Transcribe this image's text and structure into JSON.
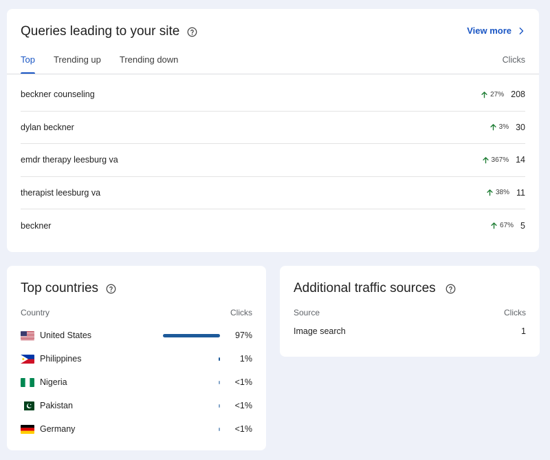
{
  "queries": {
    "title": "Queries leading to your site",
    "view_more": "View more",
    "tabs": [
      {
        "label": "Top",
        "active": true
      },
      {
        "label": "Trending up",
        "active": false
      },
      {
        "label": "Trending down",
        "active": false
      }
    ],
    "clicks_header": "Clicks",
    "rows": [
      {
        "query": "beckner counseling",
        "change": "27%",
        "clicks": "208"
      },
      {
        "query": "dylan beckner",
        "change": "3%",
        "clicks": "30"
      },
      {
        "query": "emdr therapy leesburg va",
        "change": "367%",
        "clicks": "14"
      },
      {
        "query": "therapist leesburg va",
        "change": "38%",
        "clicks": "11"
      },
      {
        "query": "beckner",
        "change": "67%",
        "clicks": "5"
      }
    ],
    "trend_icon": "arrow-up-icon",
    "trend_color": "#1e7d34"
  },
  "countries": {
    "title": "Top countries",
    "col_country": "Country",
    "col_clicks": "Clicks",
    "rows": [
      {
        "name": "United States",
        "flag": "us-flag-icon",
        "share": 0.97,
        "pct": "97%"
      },
      {
        "name": "Philippines",
        "flag": "ph-flag-icon",
        "share": 0.01,
        "pct": "1%"
      },
      {
        "name": "Nigeria",
        "flag": "ng-flag-icon",
        "share": 0.005,
        "pct": "<1%"
      },
      {
        "name": "Pakistan",
        "flag": "pk-flag-icon",
        "share": 0.005,
        "pct": "<1%"
      },
      {
        "name": "Germany",
        "flag": "de-flag-icon",
        "share": 0.005,
        "pct": "<1%"
      }
    ],
    "bar_color": "#1d5a9a"
  },
  "sources": {
    "title": "Additional traffic sources",
    "col_source": "Source",
    "col_clicks": "Clicks",
    "rows": [
      {
        "source": "Image search",
        "clicks": "1"
      }
    ]
  },
  "colors": {
    "accent": "#1a56c4",
    "background": "#eef1f9"
  }
}
